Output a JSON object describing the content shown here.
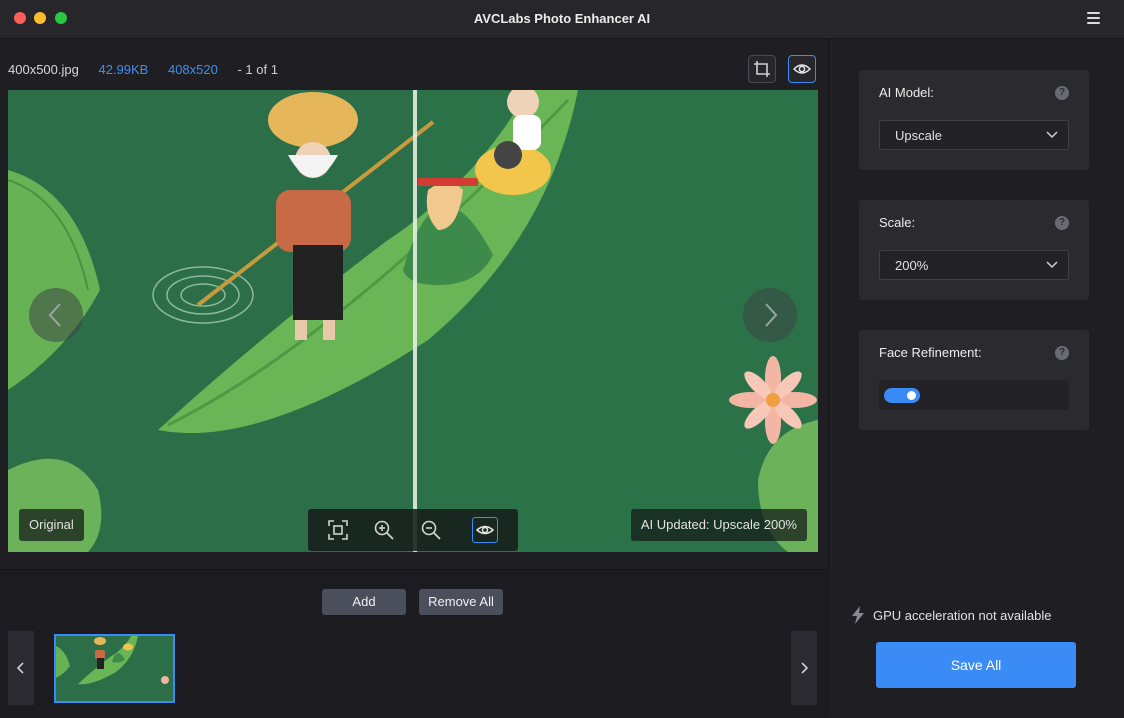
{
  "window": {
    "title": "AVCLabs Photo Enhancer AI"
  },
  "file_info": {
    "name": "400x500.jpg",
    "size": "42.99KB",
    "output_dimensions": "408x520",
    "count": "- 1 of 1"
  },
  "preview": {
    "original_label": "Original",
    "ai_label": "AI Updated: Upscale 200%"
  },
  "actions": {
    "add_label": "Add",
    "remove_all_label": "Remove All",
    "save_all_label": "Save All"
  },
  "settings": {
    "ai_model": {
      "label": "AI Model:",
      "value": "Upscale"
    },
    "scale": {
      "label": "Scale:",
      "value": "200%"
    },
    "face_refinement": {
      "label": "Face Refinement:",
      "enabled": true
    },
    "help_glyph": "?"
  },
  "gpu_note": "GPU acceleration not available",
  "colors": {
    "accent": "#3a8bf5",
    "background": "#1f1f23",
    "panel": "#2a2a2f",
    "scene_water": "#2b6e47",
    "scene_leaf": "#5aa34f"
  },
  "icons": {
    "crop": "crop-icon",
    "eye": "eye-icon",
    "fit": "fit-screen-icon",
    "zoom_in": "zoom-in-icon",
    "zoom_out": "zoom-out-icon",
    "prev": "chevron-left-icon",
    "next": "chevron-right-icon",
    "dropdown": "chevron-down-icon",
    "menu": "hamburger-menu-icon",
    "gpu": "lightning-icon",
    "help": "help-icon"
  }
}
